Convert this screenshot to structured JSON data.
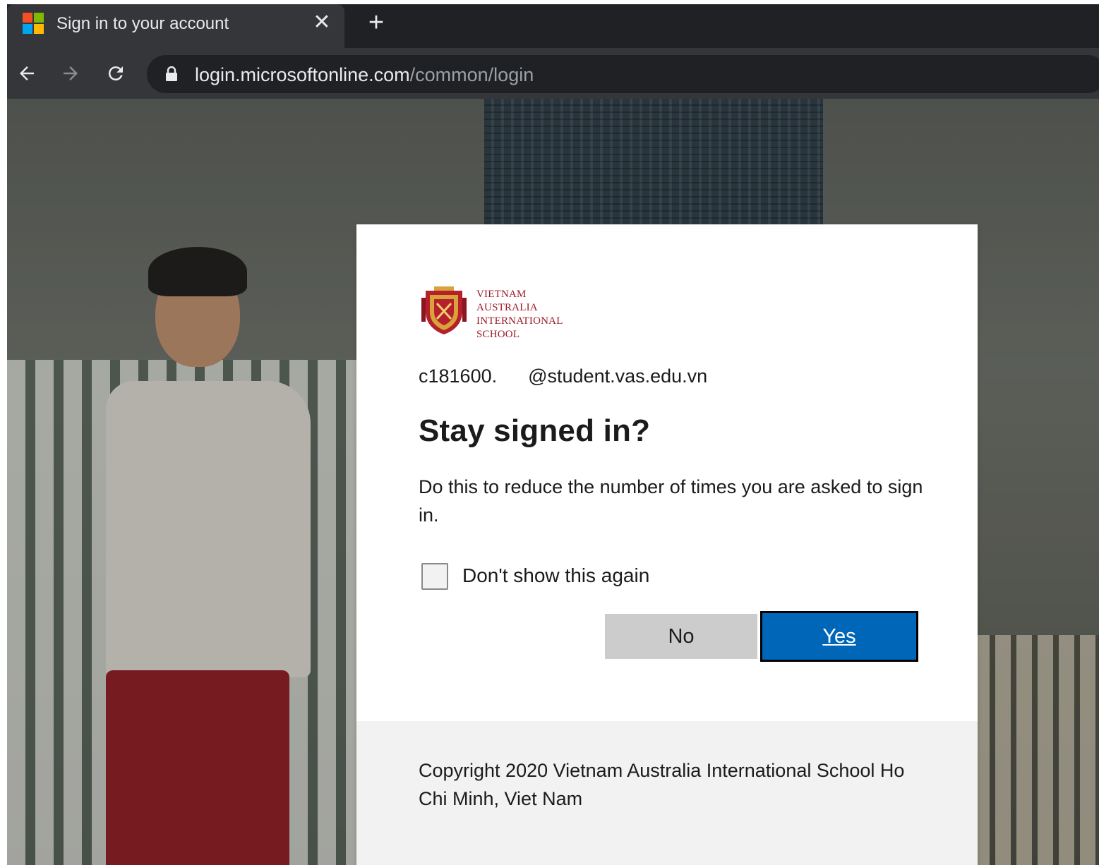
{
  "browser": {
    "tab_title": "Sign in to your account",
    "tab_close": "✕",
    "new_tab": "+",
    "url_host": "login.microsoftonline.com",
    "url_path": "/common/login"
  },
  "logo": {
    "lines": [
      "VIETNAM",
      "AUSTRALIA",
      "INTERNATIONAL",
      "SCHOOL"
    ]
  },
  "dialog": {
    "identity_prefix": "c181600.",
    "identity_suffix": "@student.vas.edu.vn",
    "title": "Stay signed in?",
    "description": "Do this to reduce the number of times you are asked to sign in.",
    "checkbox_label": "Don't show this again",
    "checkbox_checked": false,
    "no_label": "No",
    "yes_label": "Yes",
    "footer": "Copyright 2020 Vietnam Australia International School Ho Chi Minh, Viet Nam"
  },
  "colors": {
    "accent": "#0067b8",
    "brand_red": "#9b1b26"
  }
}
